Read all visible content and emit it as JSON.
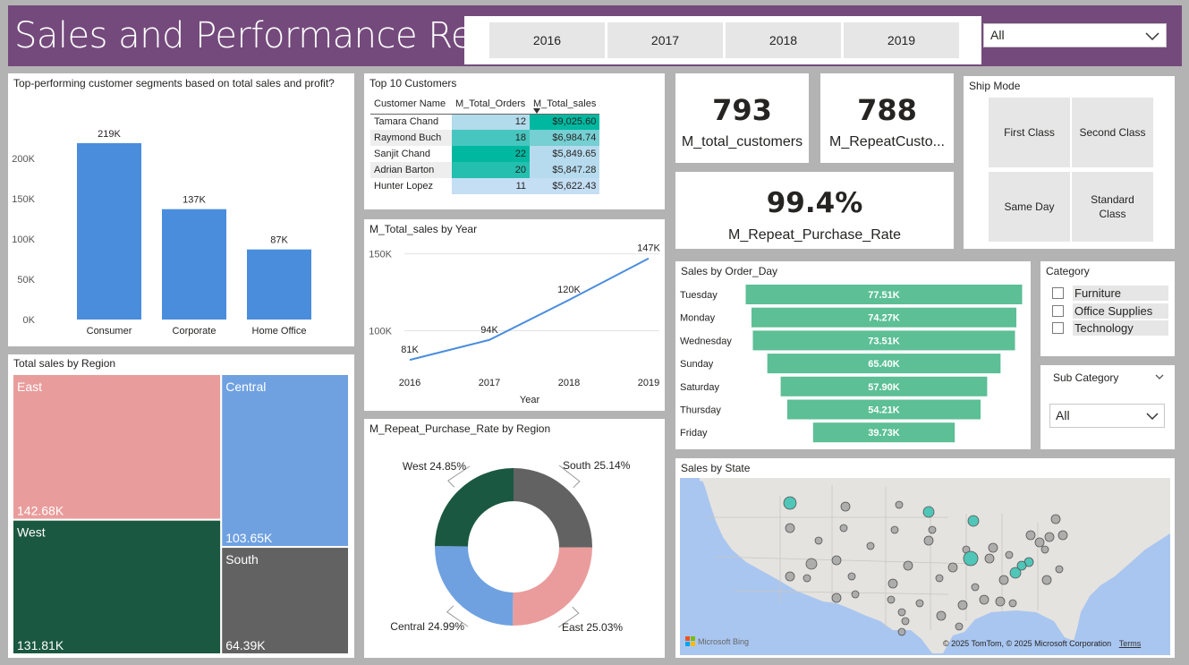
{
  "header": {
    "title": "Sales and Performance Report",
    "years": [
      "2016",
      "2017",
      "2018",
      "2019"
    ],
    "region_filter": "All"
  },
  "segments": {
    "title": "Top-performing customer segments based on total sales and profit?",
    "chart_data": {
      "type": "bar",
      "categories": [
        "Consumer",
        "Corporate",
        "Home Office"
      ],
      "values": [
        219000,
        137000,
        87000
      ],
      "data_labels": [
        "219K",
        "137K",
        "87K"
      ],
      "ylim": [
        0,
        250000
      ],
      "yticks": [
        0,
        50000,
        100000,
        150000,
        200000
      ],
      "ytick_labels": [
        "0K",
        "50K",
        "100K",
        "150K",
        "200K"
      ],
      "color": "#4a8ddd"
    }
  },
  "top_customers": {
    "title": "Top 10 Customers",
    "columns": [
      "Customer Name",
      "M_Total_Orders",
      "M_Total_sales"
    ],
    "rows": [
      {
        "name": "Tamara Chand",
        "orders": 12,
        "orders_text": "12",
        "sales": 9025.6,
        "sales_text": "$9,025.60"
      },
      {
        "name": "Raymond Buch",
        "orders": 18,
        "orders_text": "18",
        "sales": 6984.74,
        "sales_text": "$6,984.74"
      },
      {
        "name": "Sanjit Chand",
        "orders": 22,
        "orders_text": "22",
        "sales": 5849.65,
        "sales_text": "$5,849.65"
      },
      {
        "name": "Adrian Barton",
        "orders": 20,
        "orders_text": "20",
        "sales": 5847.28,
        "sales_text": "$5,847.28"
      },
      {
        "name": "Hunter Lopez",
        "orders": 11,
        "orders_text": "11",
        "sales": 5622.43,
        "sales_text": "$5,622.43"
      }
    ]
  },
  "sales_by_year": {
    "title": "M_Total_sales by Year",
    "chart_data": {
      "type": "line",
      "x": [
        "2016",
        "2017",
        "2018",
        "2019"
      ],
      "values": [
        81000,
        94000,
        120000,
        147000
      ],
      "data_labels": [
        "81K",
        "94K",
        "120K",
        "147K"
      ],
      "xlabel": "Year",
      "ylim": [
        70000,
        155000
      ],
      "yticks": [
        100000,
        150000
      ],
      "ytick_labels": [
        "100K",
        "150K"
      ],
      "color": "#4a8ddd"
    }
  },
  "repeat_rate_region": {
    "title": "M_Repeat_Purchase_Rate by Region",
    "chart_data": {
      "type": "pie",
      "categories": [
        "South",
        "East",
        "Central",
        "West"
      ],
      "values": [
        25.14,
        25.03,
        24.99,
        24.85
      ],
      "labels": [
        "South 25.14%",
        "East 25.03%",
        "Central 24.99%",
        "West 24.85%"
      ],
      "colors": [
        "#626262",
        "#ea9c9c",
        "#6fa1e1",
        "#1b5841"
      ],
      "donut": true
    }
  },
  "kpis": {
    "total_customers": {
      "value": "793",
      "label": "M_total_customers"
    },
    "repeat_customers": {
      "value": "788",
      "label": "M_RepeatCusto..."
    },
    "repeat_rate": {
      "value": "99.4%",
      "label": "M_Repeat_Purchase_Rate"
    }
  },
  "ship_mode": {
    "title": "Ship Mode",
    "options": [
      "First Class",
      "Second Class",
      "Same Day",
      "Standard Class"
    ]
  },
  "order_day": {
    "title": "Sales by Order_Day",
    "chart_data": {
      "type": "bar",
      "orientation": "funnel",
      "categories": [
        "Tuesday",
        "Monday",
        "Wednesday",
        "Sunday",
        "Saturday",
        "Thursday",
        "Friday"
      ],
      "values": [
        77510,
        74270,
        73510,
        65400,
        57900,
        54210,
        39730
      ],
      "data_labels": [
        "77.51K",
        "74.27K",
        "73.51K",
        "65.40K",
        "57.90K",
        "54.21K",
        "39.73K"
      ],
      "color": "#5cbf95"
    }
  },
  "category": {
    "title": "Category",
    "options": [
      "Furniture",
      "Office Supplies",
      "Technology"
    ]
  },
  "sub_category": {
    "title": "Sub Category",
    "value": "All"
  },
  "region_sales": {
    "title": "Total sales by Region",
    "chart_data": {
      "type": "treemap",
      "categories": [
        "East",
        "West",
        "Central",
        "South"
      ],
      "values": [
        142680,
        131810,
        103650,
        64390
      ],
      "data_labels": [
        "142.68K",
        "131.81K",
        "103.65K",
        "64.39K"
      ],
      "colors": [
        "#e99c9c",
        "#1b5841",
        "#6fa1e1",
        "#626262"
      ]
    }
  },
  "state_map": {
    "title": "Sales by State",
    "bing_label": "Microsoft Bing",
    "copyright": "© 2025 TomTom, © 2025 Microsoft Corporation",
    "terms": "Terms",
    "land_color": "#e5e3df",
    "water_color": "#a9c6f0"
  }
}
